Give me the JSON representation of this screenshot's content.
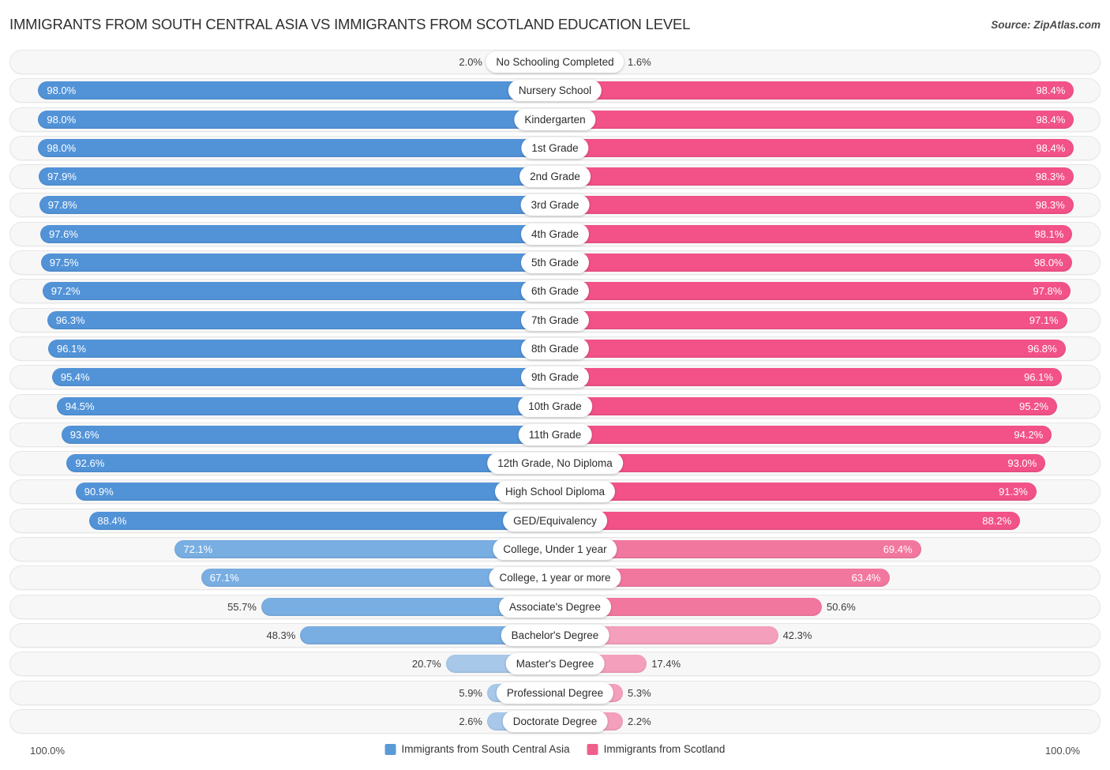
{
  "header": {
    "title": "IMMIGRANTS FROM SOUTH CENTRAL ASIA VS IMMIGRANTS FROM SCOTLAND EDUCATION LEVEL",
    "source": "Source: ZipAtlas.com"
  },
  "footer": {
    "axis_left": "100.0%",
    "axis_right": "100.0%",
    "legend": [
      {
        "label": "Immigrants from South Central Asia",
        "color": "#5b9bd5"
      },
      {
        "label": "Immigrants from Scotland",
        "color": "#ef5f8c"
      }
    ]
  },
  "colors": {
    "left_strong": "#5293d8",
    "left_mid": "#79aee2",
    "left_light": "#a8c8ea",
    "right_strong": "#f25287",
    "right_mid": "#f2779f",
    "right_light": "#f4a0bd",
    "track": "#f7f7f7"
  },
  "chart_data": {
    "type": "bar",
    "title": "IMMIGRANTS FROM SOUTH CENTRAL ASIA VS IMMIGRANTS FROM SCOTLAND EDUCATION LEVEL",
    "orientation": "horizontal-diverging",
    "xlabel": "",
    "ylabel": "",
    "xlim": [
      0,
      100
    ],
    "grid": false,
    "legend_position": "bottom-center",
    "categories": [
      "No Schooling Completed",
      "Nursery School",
      "Kindergarten",
      "1st Grade",
      "2nd Grade",
      "3rd Grade",
      "4th Grade",
      "5th Grade",
      "6th Grade",
      "7th Grade",
      "8th Grade",
      "9th Grade",
      "10th Grade",
      "11th Grade",
      "12th Grade, No Diploma",
      "High School Diploma",
      "GED/Equivalency",
      "College, Under 1 year",
      "College, 1 year or more",
      "Associate's Degree",
      "Bachelor's Degree",
      "Master's Degree",
      "Professional Degree",
      "Doctorate Degree"
    ],
    "series": [
      {
        "name": "Immigrants from South Central Asia",
        "color": "#5b9bd5",
        "values": [
          2.0,
          98.0,
          98.0,
          98.0,
          97.9,
          97.8,
          97.6,
          97.5,
          97.2,
          96.3,
          96.1,
          95.4,
          94.5,
          93.6,
          92.6,
          90.9,
          88.4,
          72.1,
          67.1,
          55.7,
          48.3,
          20.7,
          5.9,
          2.6
        ],
        "labels": [
          "2.0%",
          "98.0%",
          "98.0%",
          "98.0%",
          "97.9%",
          "97.8%",
          "97.6%",
          "97.5%",
          "97.2%",
          "96.3%",
          "96.1%",
          "95.4%",
          "94.5%",
          "93.6%",
          "92.6%",
          "90.9%",
          "88.4%",
          "72.1%",
          "67.1%",
          "55.7%",
          "48.3%",
          "20.7%",
          "5.9%",
          "2.6%"
        ]
      },
      {
        "name": "Immigrants from Scotland",
        "color": "#ef5f8c",
        "values": [
          1.6,
          98.4,
          98.4,
          98.4,
          98.3,
          98.3,
          98.1,
          98.0,
          97.8,
          97.1,
          96.8,
          96.1,
          95.2,
          94.2,
          93.0,
          91.3,
          88.2,
          69.4,
          63.4,
          50.6,
          42.3,
          17.4,
          5.3,
          2.2
        ],
        "labels": [
          "1.6%",
          "98.4%",
          "98.4%",
          "98.4%",
          "98.3%",
          "98.3%",
          "98.1%",
          "98.0%",
          "97.8%",
          "97.1%",
          "96.8%",
          "96.1%",
          "95.2%",
          "94.2%",
          "93.0%",
          "91.3%",
          "88.2%",
          "69.4%",
          "63.4%",
          "50.6%",
          "42.3%",
          "17.4%",
          "5.3%",
          "2.2%"
        ]
      }
    ]
  }
}
